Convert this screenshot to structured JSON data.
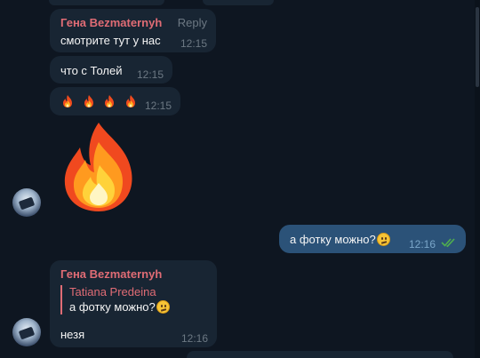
{
  "messages": [
    {
      "sender": "Гена Bezmaternyh",
      "reply_label": "Reply",
      "text": "смотрите тут у нас",
      "time": "12:15"
    },
    {
      "text": "что с Толей",
      "time": "12:15"
    },
    {
      "text": "🔥🔥🔥🔥",
      "time": "12:15"
    },
    {
      "sticker": "fire-icon"
    },
    {
      "outgoing": true,
      "text": "а фотку можно?",
      "emoji": "confused-face-icon",
      "time": "12:16",
      "status": "read-double-check-icon"
    },
    {
      "sender": "Гена Bezmaternyh",
      "quote_author": "Tatiana Predeina",
      "quote_text": "а фотку можно?",
      "text": "незя",
      "time": "12:16"
    }
  ],
  "colors": {
    "background": "#0e1621",
    "incoming_bubble": "#182533",
    "outgoing_bubble": "#2b5278",
    "sender_name": "#e06c75",
    "timestamp": "#6c7883",
    "read_check": "#4fae4e"
  }
}
